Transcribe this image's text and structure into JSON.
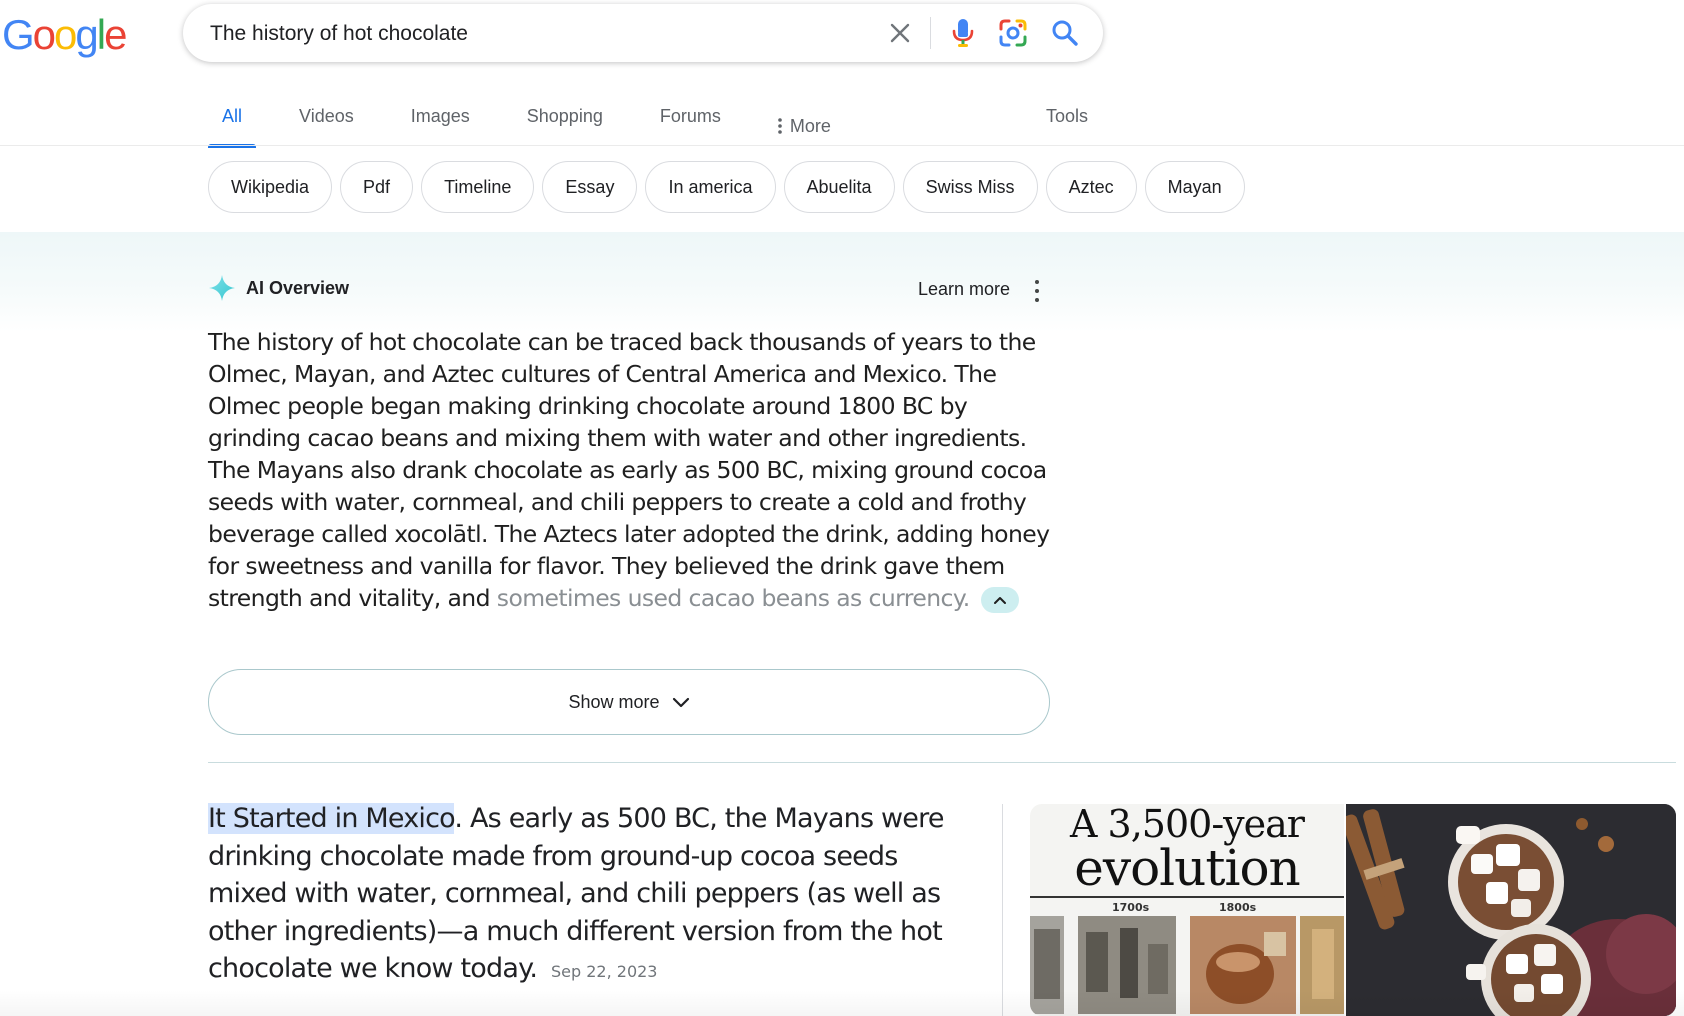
{
  "logo": {
    "letters": [
      "G",
      "o",
      "o",
      "g",
      "l",
      "e"
    ],
    "colors": [
      "#4285F4",
      "#EA4335",
      "#FBBC05",
      "#4285F4",
      "#34A853",
      "#EA4335"
    ]
  },
  "search": {
    "query": "The history of hot chocolate",
    "icons": [
      "close-icon",
      "microphone-icon",
      "google-lens-icon",
      "search-icon"
    ]
  },
  "tabs": {
    "items": [
      "All",
      "Videos",
      "Images",
      "Shopping",
      "Forums"
    ],
    "more_label": "More",
    "tools_label": "Tools",
    "active_color": "#1a73e8"
  },
  "chips": [
    "Wikipedia",
    "Pdf",
    "Timeline",
    "Essay",
    "In america",
    "Abuelita",
    "Swiss Miss",
    "Aztec",
    "Mayan"
  ],
  "ai_overview": {
    "title": "AI Overview",
    "learn_more": "Learn more",
    "text_main": "The history of hot chocolate can be traced back thousands of years to the Olmec, Mayan, and Aztec cultures of Central America and Mexico. The Olmec people began making drinking chocolate around 1800 BC by grinding cacao beans and mixing them with water and other ingredients. The Mayans also drank chocolate as early as 500 BC, mixing ground cocoa seeds with water, cornmeal, and chili peppers to create a cold and frothy beverage called xocolātl. The Aztecs later adopted the drink, adding honey for sweetness and vanilla for flavor. They believed the drink gave them strength and vitality, and",
    "text_faded": "sometimes used cacao beans as currency.",
    "show_more_label": "Show more",
    "accent_color": "#cdeef0"
  },
  "snippet": {
    "highlight": "It Started in Mexico",
    "text": ". As early as 500 BC, the Mayans were drinking chocolate made from ground-up cocoa seeds mixed with water, cornmeal, and chili peppers (as well as other ingredients)—a much different version from the hot chocolate we know today.",
    "date": "Sep 22, 2023"
  },
  "images": {
    "image1": {
      "title_line1": "A 3,500-year",
      "title_line2": "evolution",
      "label_left": "1700s",
      "label_right": "1800s"
    }
  }
}
